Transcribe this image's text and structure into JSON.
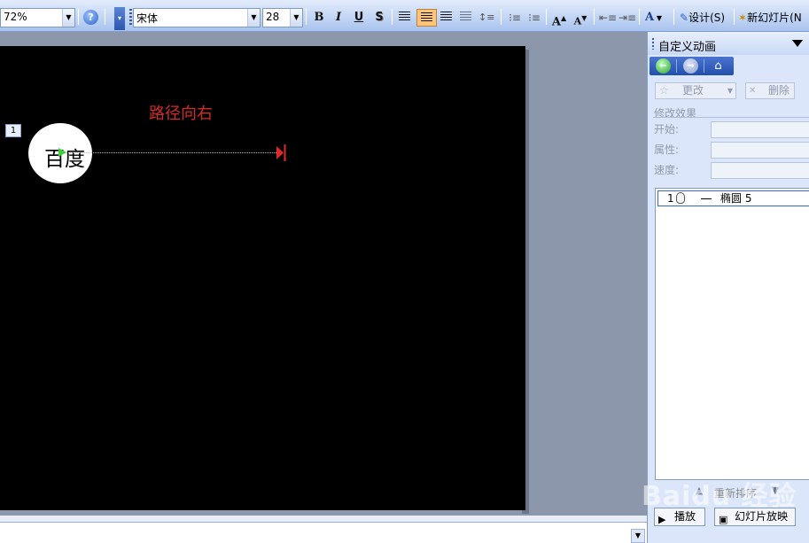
{
  "toolbar": {
    "zoom_value": "72%",
    "font_name": "宋体",
    "font_size": "28",
    "bold": "B",
    "italic": "I",
    "underline": "U",
    "shadow": "S",
    "grow_font": "A",
    "shrink_font": "A",
    "font_color": "A",
    "design_label": "设计(S)",
    "new_slide_label": "新幻灯片(N",
    "help_icon": "help-icon"
  },
  "slide": {
    "background": "#000000",
    "title": "路径向右",
    "title_color": "#d22a2a",
    "animation_tag": "1",
    "ellipse_text": "百度"
  },
  "task_pane": {
    "title": "自定义动画",
    "add_effect_label": "更改",
    "remove_label": "删除",
    "modify_header": "修改效果",
    "start_label": "开始:",
    "property_label": "属性:",
    "speed_label": "速度:",
    "animation_items": [
      {
        "order": "1",
        "trigger": "mouse-click-icon",
        "name": "椭圆 5"
      }
    ],
    "reorder_label": "重新排序",
    "play_label": "播放",
    "slideshow_label": "幻灯片放映"
  },
  "watermark": "Baidu 经验"
}
